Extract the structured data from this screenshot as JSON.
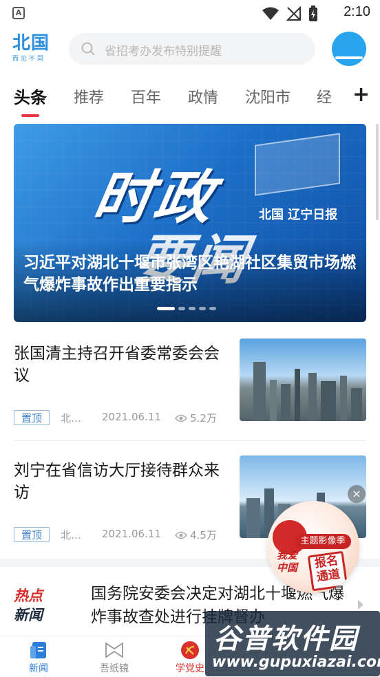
{
  "status_bar": {
    "time": "2:10",
    "notification_icon": "A"
  },
  "header": {
    "logo_main": "北国",
    "logo_sub": "而见不同",
    "search_placeholder": "省招考办发布特别提醒"
  },
  "tabs": [
    {
      "label": "头条",
      "active": true
    },
    {
      "label": "推荐"
    },
    {
      "label": "百年"
    },
    {
      "label": "政情"
    },
    {
      "label": "沈阳市"
    },
    {
      "label": "经"
    }
  ],
  "tab_plus": "+",
  "banner": {
    "image_text_1": "时政",
    "image_text_2": "要闻",
    "image_logos": "北国 辽宁日报",
    "title": "习近平对湖北十堰市张湾区艳湖社区集贸市场燃气爆炸事故作出重要指示",
    "dots": 5,
    "active_dot": 0
  },
  "news": [
    {
      "title": "张国清主持召开省委常委会会议",
      "tag": "置顶",
      "source": "北…",
      "date": "2021.06.11",
      "views": "5.2万"
    },
    {
      "title": "刘宁在省信访大厅接待群众来访",
      "tag": "置顶",
      "source": "北…",
      "date": "2021.06.11",
      "views": "4.5万"
    }
  ],
  "hot_news": {
    "logo_line1": "热点",
    "logo_line2": "新闻",
    "title": "国务院安委会决定对湖北十堰燃气爆炸事故查处进行挂牌督办"
  },
  "promo": {
    "badge": "主题影像季",
    "sign": "报名通道",
    "slogan": "我爱中国",
    "close": "×"
  },
  "tabbar": [
    {
      "label": "新闻",
      "state": "active"
    },
    {
      "label": "吾纸镜"
    },
    {
      "label": "学党史",
      "state": "red"
    }
  ],
  "watermark": {
    "text": "谷普软件园",
    "url": "www.gupuxiazai.com"
  },
  "colors": {
    "accent": "#2d8fe0",
    "tab_indicator": "#e23a3a",
    "hot_red": "#d9302c"
  }
}
